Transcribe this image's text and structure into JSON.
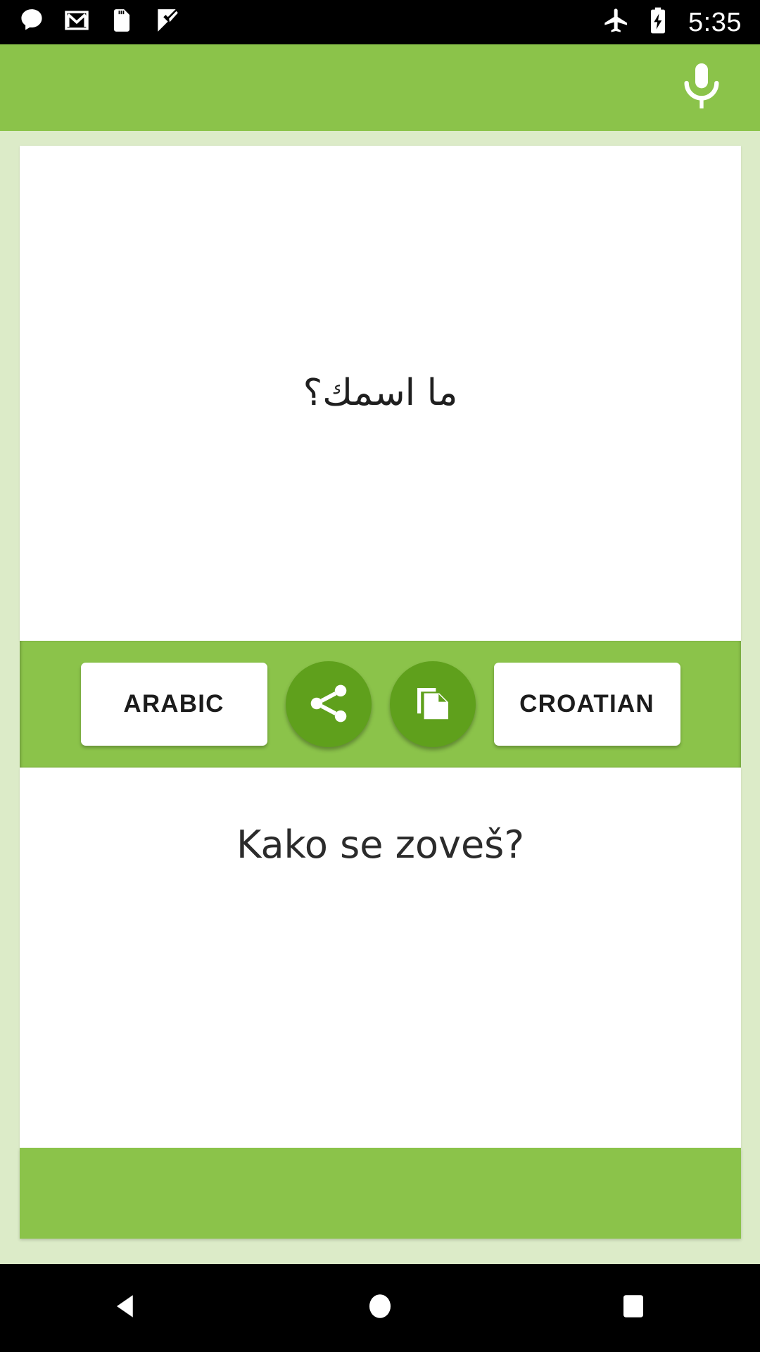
{
  "status_bar": {
    "left_icons": [
      {
        "name": "messages-icon",
        "label": "messages"
      },
      {
        "name": "gmail-icon",
        "label": "gmail"
      },
      {
        "name": "sd-card-icon",
        "label": "sd-card"
      },
      {
        "name": "tasks-check-icon",
        "label": "tasks"
      }
    ],
    "right_icons": [
      {
        "name": "airplane-mode-icon",
        "label": "airplane mode"
      },
      {
        "name": "battery-charging-icon",
        "label": "battery charging"
      }
    ],
    "clock": "5:35",
    "background": "#000000",
    "foreground": "#FFFFFF"
  },
  "app_bar": {
    "title": "",
    "mic_icon": "microphone-icon",
    "background": "#8BC34A"
  },
  "translation": {
    "source": {
      "text": "ما اسمك؟",
      "language_label": "ARABIC",
      "direction": "rtl"
    },
    "target": {
      "text": "Kako se zoveš?",
      "language_label": "CROATIAN",
      "direction": "ltr"
    }
  },
  "actions": [
    {
      "name": "share-button",
      "icon": "share-icon"
    },
    {
      "name": "copy-button",
      "icon": "copy-icon"
    }
  ],
  "nav_bar": {
    "buttons": [
      {
        "name": "back-button",
        "icon": "back-triangle-icon"
      },
      {
        "name": "home-button",
        "icon": "home-circle-icon"
      },
      {
        "name": "recents-button",
        "icon": "recents-square-icon"
      }
    ]
  },
  "colors": {
    "accent_green": "#8BC34A",
    "dark_green": "#5FA01C",
    "page_background": "#DCEBC8",
    "panel_background": "#FFFFFF",
    "text_primary": "#1F1F1F"
  }
}
